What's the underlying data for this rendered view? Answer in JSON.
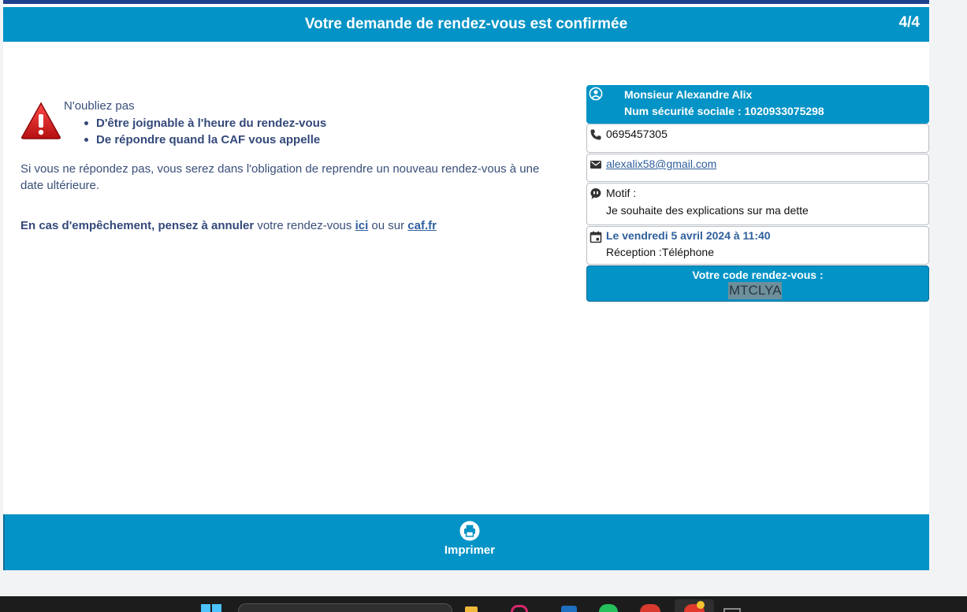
{
  "header": {
    "title": "Votre demande de rendez-vous est confirmée",
    "step": "4/4"
  },
  "reminder": {
    "title": "N'oubliez pas",
    "items": [
      "D'être joignable à l'heure du rendez-vous",
      "De répondre quand la CAF vous appelle"
    ]
  },
  "warning_text": "Si vous ne répondez pas, vous serez dans l'obligation de reprendre un nouveau rendez-vous à une date ultérieure.",
  "cancel": {
    "bold": "En cas d'empêchement, pensez à annuler",
    "middle": " votre rendez-vous ",
    "link_here": "ici",
    "or_text": " ou sur ",
    "link_caf": "caf.fr"
  },
  "user": {
    "name": "Monsieur Alexandre Alix",
    "ssn": "Num sécurité sociale : 1020933075298"
  },
  "phone": "0695457305",
  "email": "alexalix58@gmail.com",
  "motif": {
    "label": "Motif :",
    "reason": "Je souhaite des explications sur ma dette"
  },
  "appointment": {
    "date": "Le vendredi 5 avril 2024 à 11:40",
    "reception": "Réception :Téléphone"
  },
  "code": {
    "label": "Votre code rendez-vous :",
    "value": "MTCLYA"
  },
  "footer": {
    "print_label": "Imprimer"
  },
  "colors": {
    "accent": "#0493c6",
    "text": "#3a4f7a",
    "link": "#2e5f9c",
    "top_strip": "#1f3f8f"
  },
  "icons": [
    "warning-icon",
    "user-circle-icon",
    "phone-icon",
    "mail-icon",
    "speech-bubble-icon",
    "calendar-icon",
    "printer-icon"
  ]
}
